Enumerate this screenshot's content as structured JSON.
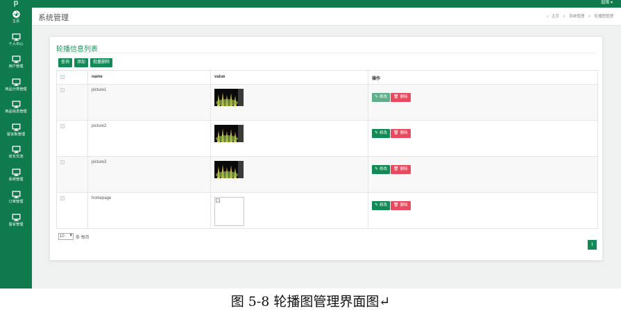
{
  "topbar": {
    "user": "超级 ▾"
  },
  "sidebar": {
    "logo": "p",
    "items": [
      {
        "label": "主页",
        "icon": "dashboard-icon"
      },
      {
        "label": "个人中心",
        "icon": "monitor-icon"
      },
      {
        "label": "用户管理",
        "icon": "monitor-icon"
      },
      {
        "label": "商品分类管理",
        "icon": "monitor-icon"
      },
      {
        "label": "商品信息管理",
        "icon": "monitor-icon"
      },
      {
        "label": "留言板管理",
        "icon": "monitor-icon"
      },
      {
        "label": "成长交流",
        "icon": "monitor-icon"
      },
      {
        "label": "系统管理",
        "icon": "monitor-icon"
      },
      {
        "label": "订单管理",
        "icon": "monitor-icon"
      },
      {
        "label": "留言管理",
        "icon": "monitor-icon"
      }
    ]
  },
  "header": {
    "title": "系统管理",
    "breadcrumb": [
      "主页",
      "系统管理",
      "轮播图管理"
    ],
    "breadcrumb_sep": ">"
  },
  "card": {
    "title": "轮播信息列表",
    "toolbar": {
      "query": "查询",
      "add": "添加",
      "batch_delete": "批量删除"
    },
    "columns": [
      "",
      "name",
      "value",
      "操作"
    ],
    "rows": [
      {
        "name": "picture1",
        "image": "thumbnail",
        "edit": "修改",
        "delete": "删除"
      },
      {
        "name": "picture2",
        "image": "thumbnail",
        "edit": "修改",
        "delete": "删除"
      },
      {
        "name": "picture3",
        "image": "thumbnail",
        "edit": "修改",
        "delete": "删除"
      },
      {
        "name": "homepage",
        "image": "broken",
        "edit": "修改",
        "delete": "删除"
      }
    ],
    "pager": {
      "page_size": "10",
      "per_page_label": "条 每页",
      "current_page": "1"
    }
  },
  "caption": "图 5-8 轮播图管理界面图↵",
  "colors": {
    "brand": "#0f7a4b",
    "accent": "#15985a",
    "danger": "#e84a5f"
  }
}
